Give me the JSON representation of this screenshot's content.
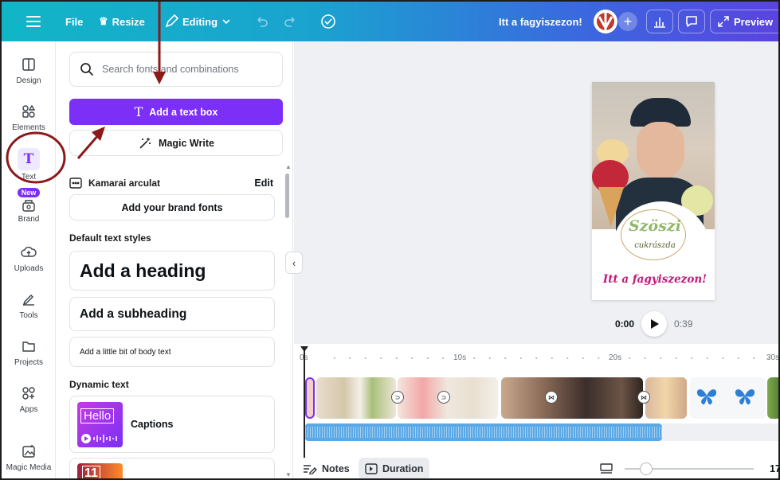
{
  "topbar": {
    "file": "File",
    "resize": "Resize",
    "editing": "Editing",
    "title": "Itt a fagyiszezon!",
    "preview": "Preview"
  },
  "rail": {
    "items": [
      {
        "label": "Design"
      },
      {
        "label": "Elements"
      },
      {
        "label": "Text"
      },
      {
        "label": "Brand",
        "badge": "New"
      },
      {
        "label": "Uploads"
      },
      {
        "label": "Tools"
      },
      {
        "label": "Projects"
      },
      {
        "label": "Apps"
      },
      {
        "label": "Magic Media"
      }
    ]
  },
  "panel": {
    "search_placeholder": "Search fonts and combinations",
    "add_text_box": "Add a text box",
    "magic_write": "Magic Write",
    "brand_kit": "Kamarai arculat",
    "edit": "Edit",
    "add_brand_fonts": "Add your brand fonts",
    "default_styles": "Default text styles",
    "heading": "Add a heading",
    "subheading": "Add a subheading",
    "body": "Add a little bit of body text",
    "dynamic_text": "Dynamic text",
    "captions": "Captions",
    "captions_thumb": "Hello",
    "next_thumb": "11"
  },
  "design": {
    "logo_main": "Szöszi",
    "logo_sub": "cukrászda",
    "headline": "Itt a fagyiszezon!"
  },
  "player": {
    "current": "0:00",
    "total": "0:39"
  },
  "timeline": {
    "marks": [
      "0s",
      "10s",
      "20s",
      "30s"
    ]
  },
  "footer": {
    "notes": "Notes",
    "duration": "Duration",
    "zoom": "17"
  },
  "colors": {
    "accent": "#7b2ff7",
    "annotation": "#8b1a1a",
    "headline": "#c2187a",
    "audio": "#5aa9e6"
  }
}
